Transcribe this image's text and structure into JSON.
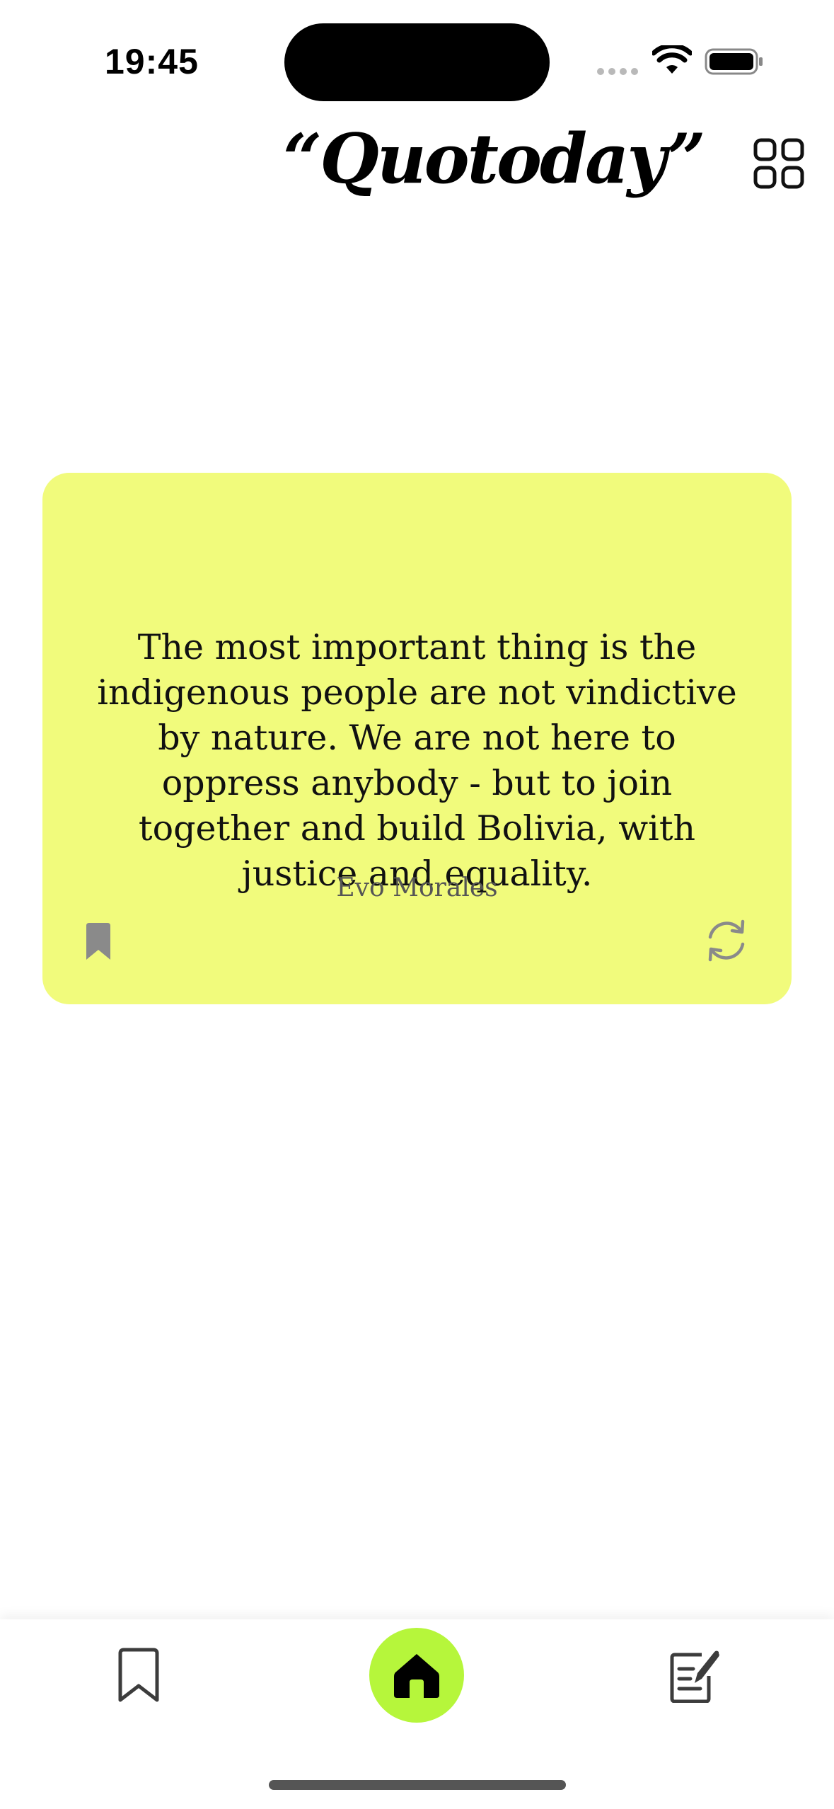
{
  "status_bar": {
    "time": "19:45"
  },
  "header": {
    "app_logo": "“Quotoday”",
    "menu_icon": "grid-icon"
  },
  "quote": {
    "text": "The most important thing is the indigenous people are not vindictive by nature. We are not here to oppress anybody - but to join together and build Bolivia, with justice and equality.",
    "author": "Evo Morales",
    "card_color": "#f1fb7c",
    "bookmark_icon": "bookmark-filled-icon",
    "refresh_icon": "refresh-icon"
  },
  "tab_bar": {
    "items": [
      {
        "icon": "bookmark-outline-icon",
        "selected": false
      },
      {
        "icon": "home-icon",
        "selected": true
      },
      {
        "icon": "write-note-icon",
        "selected": false
      }
    ],
    "accent_color": "#b6f63b"
  }
}
